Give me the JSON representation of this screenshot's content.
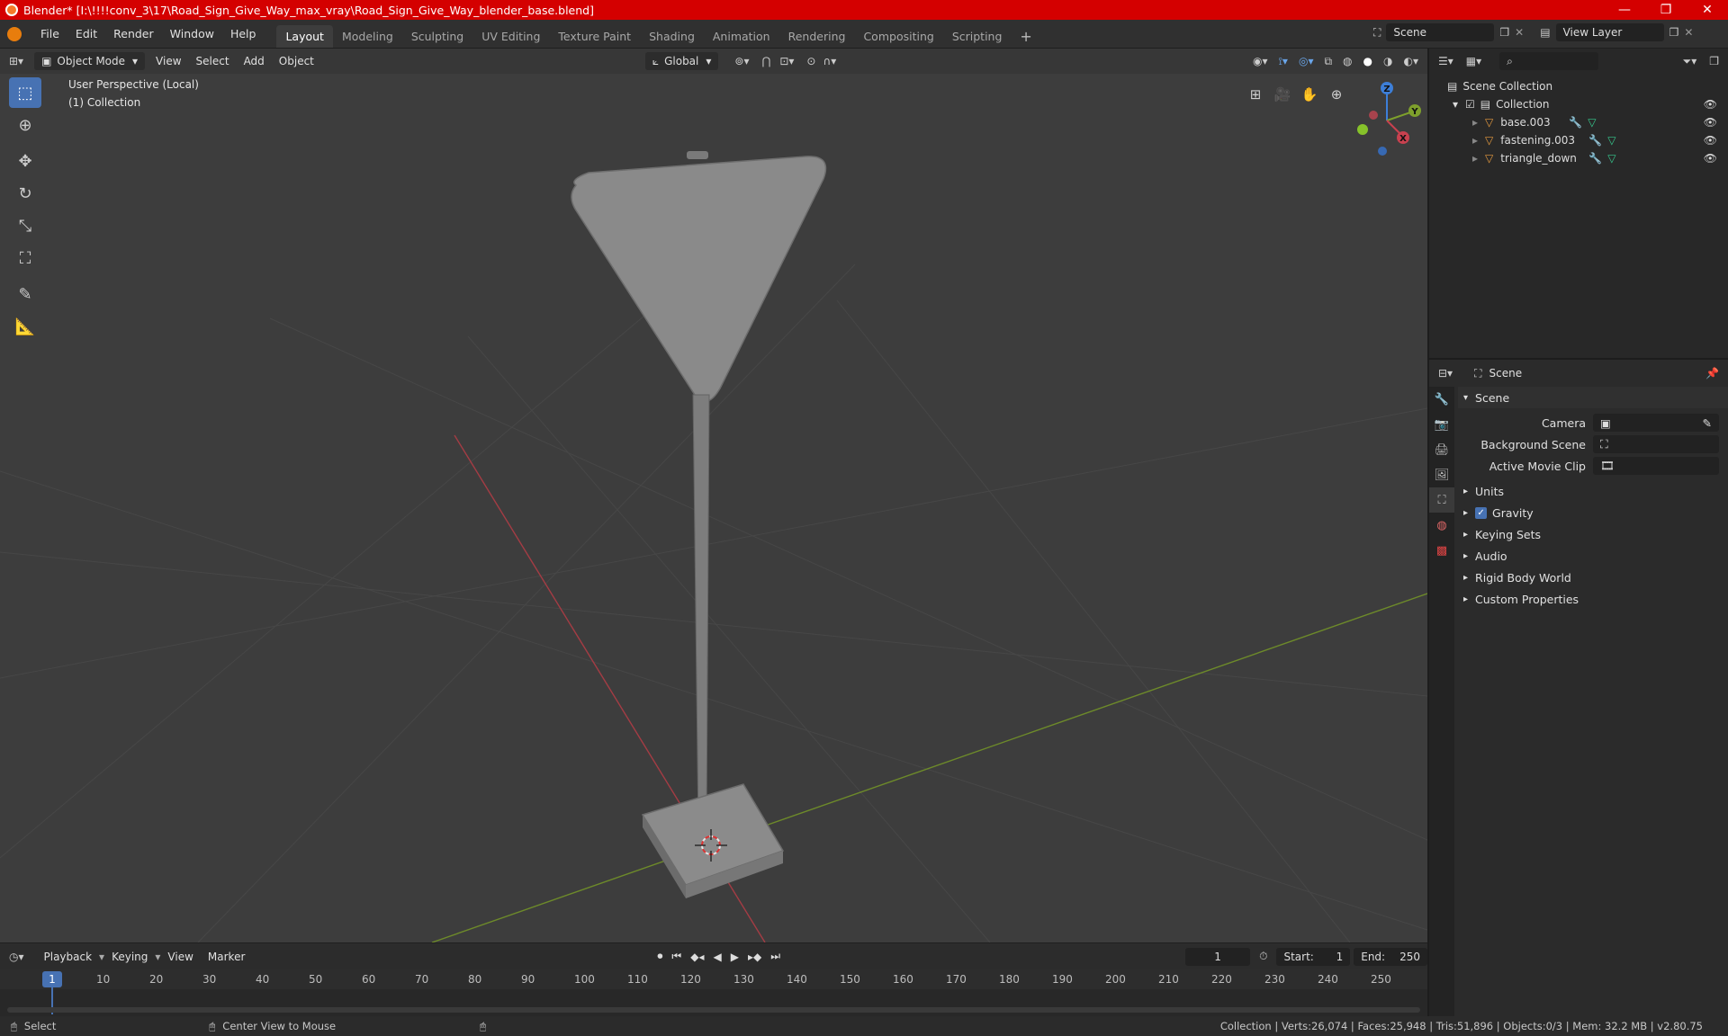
{
  "window": {
    "title": "Blender* [I:\\!!!!conv_3\\17\\Road_Sign_Give_Way_max_vray\\Road_Sign_Give_Way_blender_base.blend]",
    "minimize": "—",
    "maximize": "❐",
    "close": "✕"
  },
  "menu": {
    "items": [
      "File",
      "Edit",
      "Render",
      "Window",
      "Help"
    ]
  },
  "workspaces": {
    "tabs": [
      "Layout",
      "Modeling",
      "Sculpting",
      "UV Editing",
      "Texture Paint",
      "Shading",
      "Animation",
      "Rendering",
      "Compositing",
      "Scripting"
    ],
    "active": "Layout",
    "add": "+"
  },
  "scene_selector": {
    "value": "Scene"
  },
  "view_layer": {
    "value": "View Layer"
  },
  "viewport_header": {
    "mode": "Object Mode",
    "menus": [
      "View",
      "Select",
      "Add",
      "Object"
    ],
    "transform_orientation": "Global"
  },
  "viewport": {
    "perspective": "User Perspective (Local)",
    "collection": "(1) Collection",
    "gizmo": {
      "x": "X",
      "y": "Y",
      "z": "Z"
    },
    "colors": {
      "x_axis": "#c8414f",
      "y_axis": "#7ea02c",
      "z_axis": "#3d7fd9",
      "bg": "#3d3d3d"
    }
  },
  "timeline": {
    "menus": [
      "Playback",
      "Keying",
      "View",
      "Marker"
    ],
    "current_frame": "1",
    "start_label": "Start:",
    "start": "1",
    "end_label": "End:",
    "end": "250",
    "ruler": [
      "10",
      "20",
      "30",
      "40",
      "50",
      "60",
      "70",
      "80",
      "90",
      "100",
      "110",
      "120",
      "130",
      "140",
      "150",
      "160",
      "170",
      "180",
      "190",
      "200",
      "210",
      "220",
      "230",
      "240",
      "250"
    ],
    "frame_indicator": "1"
  },
  "status": {
    "select": "Select",
    "center_view": "Center View to Mouse",
    "stats": "Collection | Verts:26,074 | Faces:25,948 | Tris:51,896 | Objects:0/3 | Mem: 32.2 MB | v2.80.75"
  },
  "outliner": {
    "root": "Scene Collection",
    "collection": "Collection",
    "objects": [
      "base.003",
      "fastening.003",
      "triangle_down"
    ]
  },
  "properties": {
    "context": "Scene",
    "panel": "Scene",
    "camera_label": "Camera",
    "background_scene_label": "Background Scene",
    "movie_clip_label": "Active Movie Clip",
    "sections": [
      "Units",
      "Gravity",
      "Keying Sets",
      "Audio",
      "Rigid Body World",
      "Custom Properties"
    ]
  }
}
